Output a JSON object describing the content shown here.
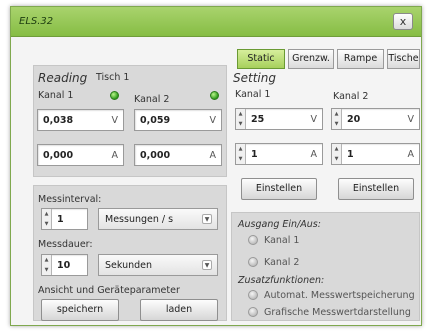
{
  "window": {
    "title": "ELS.32",
    "close_label": "x"
  },
  "tabs": [
    {
      "label": "Static",
      "active": true
    },
    {
      "label": "Grenzw.",
      "active": false
    },
    {
      "label": "Rampe",
      "active": false
    },
    {
      "label": "Tische",
      "active": false
    }
  ],
  "reading": {
    "title": "Reading",
    "table": "Tisch 1",
    "kanal1": {
      "label": "Kanal 1",
      "voltage": "0,038",
      "voltage_unit": "V",
      "current": "0,000",
      "current_unit": "A"
    },
    "kanal2": {
      "label": "Kanal 2",
      "voltage": "0,059",
      "voltage_unit": "V",
      "current": "0,000",
      "current_unit": "A"
    }
  },
  "setting": {
    "title": "Setting",
    "kanal1": {
      "label": "Kanal 1",
      "voltage": "25",
      "voltage_unit": "V",
      "current": "1",
      "current_unit": "A",
      "button": "Einstellen"
    },
    "kanal2": {
      "label": "Kanal 2",
      "voltage": "20",
      "voltage_unit": "V",
      "current": "1",
      "current_unit": "A",
      "button": "Einstellen"
    }
  },
  "measure": {
    "interval_label": "Messinterval:",
    "interval_value": "1",
    "interval_unit": "Messungen / s",
    "duration_label": "Messdauer:",
    "duration_value": "10",
    "duration_unit": "Sekunden",
    "params_label": "Ansicht und Geräteparameter",
    "save_button": "speichern",
    "load_button": "laden"
  },
  "output": {
    "title": "Ausgang Ein/Aus:",
    "kanal1": "Kanal 1",
    "kanal2": "Kanal 2"
  },
  "extras": {
    "title": "Zusatzfunktionen:",
    "auto_save": "Automat. Messwertspeicherung",
    "graph": "Grafische Messwertdarstellung"
  }
}
